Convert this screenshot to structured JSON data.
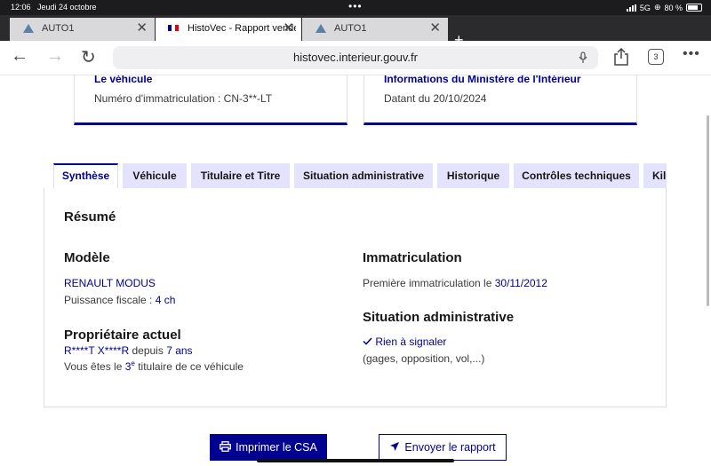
{
  "status_bar": {
    "time": "12:06",
    "date": "Jeudi 24 octobre",
    "network": "5G",
    "battery": "80 %"
  },
  "browser": {
    "tabs": [
      {
        "title": "AUTO1",
        "active": false
      },
      {
        "title": "HistoVec - Rapport vendeur",
        "active": true
      },
      {
        "title": "AUTO1",
        "active": false
      }
    ],
    "url": "histovec.interieur.gouv.fr",
    "tab_count": "3"
  },
  "cards": [
    {
      "title": "Le véhicule",
      "value": "Numéro d'immatriculation : CN-3**-LT"
    },
    {
      "title": "Informations du Ministère de l'Intérieur",
      "value": "Datant du 20/10/2024"
    }
  ],
  "page_tabs": [
    "Synthèse",
    "Véhicule",
    "Titulaire et Titre",
    "Situation administrative",
    "Historique",
    "Contrôles techniques",
    "Kilométrage"
  ],
  "summary": {
    "heading": "Résumé",
    "model": {
      "heading": "Modèle",
      "name": "RENAULT MODUS",
      "power_label": "Puissance fiscale : ",
      "power_value": "4 ch"
    },
    "owner": {
      "heading": "Propriétaire actuel",
      "name": "R****T X****R",
      "since_label": " depuis ",
      "since_value": "7 ans",
      "titular_prefix": "Vous êtes le ",
      "titular_number": "3",
      "titular_suffix": "e",
      "titular_rest": " titulaire de ce véhicule"
    },
    "registration": {
      "heading": "Immatriculation",
      "label": "Première immatriculation le ",
      "date": "30/11/2012"
    },
    "admin": {
      "heading": "Situation administrative",
      "status": "Rien à signaler",
      "detail": "(gages, opposition, vol,...)"
    }
  },
  "actions": {
    "print": "Imprimer le CSA",
    "send": "Envoyer le rapport"
  },
  "colors": {
    "primary": "#000091",
    "tab_bg": "#e3e3fd"
  }
}
